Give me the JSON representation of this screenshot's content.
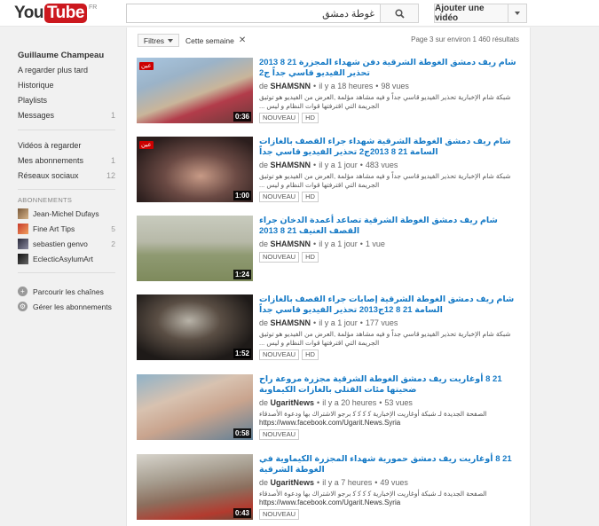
{
  "header": {
    "logo_you": "You",
    "logo_tube": "Tube",
    "logo_locale": "FR",
    "search_value": "غوطة دمشق",
    "upload_label": "Ajouter une vidéo"
  },
  "sidebar": {
    "user": "Guillaume Champeau",
    "items": [
      {
        "label": "A regarder plus tard",
        "count": ""
      },
      {
        "label": "Historique",
        "count": ""
      },
      {
        "label": "Playlists",
        "count": ""
      },
      {
        "label": "Messages",
        "count": "1"
      }
    ],
    "items2": [
      {
        "label": "Vidéos à regarder",
        "count": ""
      },
      {
        "label": "Mes abonnements",
        "count": "1"
      },
      {
        "label": "Réseaux sociaux",
        "count": "12"
      }
    ],
    "subs_heading": "ABONNEMENTS",
    "subscriptions": [
      {
        "name": "Jean-Michel Dufays",
        "count": ""
      },
      {
        "name": "Fine Art Tips",
        "count": "5"
      },
      {
        "name": "sebastien genvo",
        "count": "2"
      },
      {
        "name": "EclecticAsylumArt",
        "count": ""
      }
    ],
    "tools": [
      {
        "label": "Parcourir les chaînes"
      },
      {
        "label": "Gérer les abonnements"
      }
    ]
  },
  "filters": {
    "button_label": "Filtres",
    "active_chip": "Cette semaine",
    "results_count": "Page 3 sur environ 1 460 résultats"
  },
  "results": [
    {
      "title": "شام ريف دمشق الغوطة الشرقية دفن شهداء المجزرة 21 8 2013 تحذير الفيديو قاسي جداً ج2",
      "author": "SHAMSNN",
      "age": "il y a 18 heures",
      "views": "98 vues",
      "desc": "شبكة شام الإخبارية تحذير الفيديو قاسي جداً و فيه مشاهد مؤلمة ,العرض من الفيديو هو توثيق الجريمة التي اقترفتها قوات النظام و ليس ...",
      "desc_link": "",
      "tags": [
        "NOUVEAU",
        "HD"
      ],
      "duration": "0:36"
    },
    {
      "title": "شام ريف دمشق الغوطة الشرقية شهداء جراء القصف بالغازات السامة 21 8 2013ج2 تحذير الفيديو قاسي جداً",
      "author": "SHAMSNN",
      "age": "il y a 1 jour",
      "views": "483 vues",
      "desc": "شبكة شام الإخبارية تحذير الفيديو قاسي جداً و فيه مشاهد مؤلمة ,العرض من الفيديو هو توثيق الجريمة التي اقترفتها قوات النظام و ليس ...",
      "desc_link": "",
      "tags": [
        "NOUVEAU",
        "HD"
      ],
      "duration": "1:00"
    },
    {
      "title": "شام ريف دمشق الغوطة الشرقية تصاعد أعمدة الدخان جراء القصف العنيف 21 8 2013",
      "author": "SHAMSNN",
      "age": "il y a 1 jour",
      "views": "1 vue",
      "desc": "",
      "desc_link": "",
      "tags": [
        "NOUVEAU",
        "HD"
      ],
      "duration": "1:24"
    },
    {
      "title": "شام ريف دمشق الغوطة الشرقية إصابات جراء القصف بالغازات السامة 21 8 12ج2013 تحذير الفيديو قاسي جداً",
      "author": "SHAMSNN",
      "age": "il y a 1 jour",
      "views": "177 vues",
      "desc": "شبكة شام الإخبارية تحذير الفيديو قاسي جداً و فيه مشاهد مؤلمة ,العرض من الفيديو هو توثيق الجريمة التي اقترفتها قوات النظام و ليس ...",
      "desc_link": "",
      "tags": [
        "NOUVEAU",
        "HD"
      ],
      "duration": "1:52"
    },
    {
      "title": "21 8 أوغاريت ريف دمشق الغوطة الشرقية مجزرة مروعة راح ضحيتها مئات القتلى بالغازات الكيماوية",
      "author": "UgaritNews",
      "age": "il y a 20 heures",
      "views": "53 vues",
      "desc": "الصفحة الجديدة لـ شبكة أوغاريت الإخبارية ﮐ ﮐ ﮐ ﮐ برجو الاشتراك بها ودعوة الأصدقاء",
      "desc_link": "https://www.facebook.com/Ugarit.News.Syria",
      "tags": [
        "NOUVEAU"
      ],
      "duration": "0:58"
    },
    {
      "title": "21 8 أوغاريت ريف دمشق حمورية شهداء المجزرة الكيماوية في الغوطة الشرقية",
      "author": "UgaritNews",
      "age": "il y a 7 heures",
      "views": "49 vues",
      "desc": "الصفحة الجديدة لـ شبكة أوغاريت الإخبارية ﮐ ﮐ ﮐ ﮐ برجو الاشتراك بها ودعوة الأصدقاء",
      "desc_link": "https://www.facebook.com/Ugarit.News.Syria",
      "tags": [
        "NOUVEAU"
      ],
      "duration": "0:43"
    }
  ],
  "labels": {
    "by": "de"
  },
  "colors": {
    "accent": "#cc181e",
    "link": "#167ac6"
  }
}
